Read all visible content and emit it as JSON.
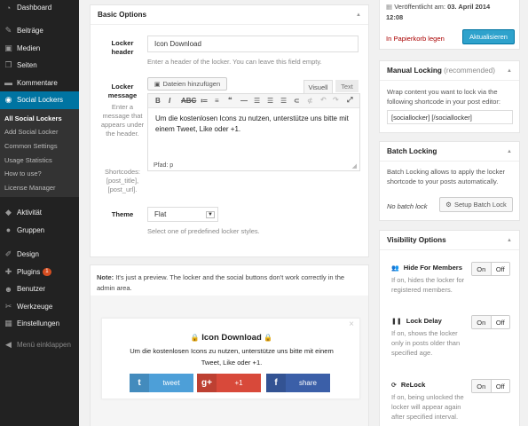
{
  "sidebar": {
    "items_top": [
      {
        "label": "Dashboard",
        "icon": "dashboard-icon",
        "glyph": "◔"
      }
    ],
    "items_mid": [
      {
        "label": "Beiträge",
        "icon": "pin-icon",
        "glyph": "✎"
      },
      {
        "label": "Medien",
        "icon": "media-icon",
        "glyph": "▣"
      },
      {
        "label": "Seiten",
        "icon": "pages-icon",
        "glyph": "❐"
      },
      {
        "label": "Kommentare",
        "icon": "comments-icon",
        "glyph": "▬"
      }
    ],
    "active": {
      "label": "Social Lockers",
      "icon": "lock-icon",
      "glyph": "◉"
    },
    "submenu": [
      "All Social Lockers",
      "Add Social Locker",
      "Common Settings",
      "Usage Statistics",
      "How to use?",
      "License Manager"
    ],
    "items_after": [
      {
        "label": "Aktivität",
        "icon": "activity-icon",
        "glyph": "◆"
      },
      {
        "label": "Gruppen",
        "icon": "groups-icon",
        "glyph": "●"
      }
    ],
    "items_bottom": [
      {
        "label": "Design",
        "icon": "design-icon",
        "glyph": "✐"
      },
      {
        "label": "Plugins",
        "icon": "plugins-icon",
        "glyph": "✚",
        "badge": "1"
      },
      {
        "label": "Benutzer",
        "icon": "users-icon",
        "glyph": "☻"
      },
      {
        "label": "Werkzeuge",
        "icon": "tools-icon",
        "glyph": "✂"
      },
      {
        "label": "Einstellungen",
        "icon": "settings-icon",
        "glyph": "▦"
      }
    ],
    "collapse": {
      "label": "Menü einklappen",
      "glyph": "◀"
    }
  },
  "basic": {
    "title": "Basic Options",
    "header_label": "Locker header",
    "header_value": "Icon Download",
    "header_help": "Enter a header of the locker. You can leave this field empty.",
    "message_label": "Locker message",
    "message_help": "Enter a message that appears under the header.",
    "shortcodes_help": "Shortcodes: [post_title], [post_url].",
    "add_media": "Dateien hinzufügen",
    "tab_visual": "Visuell",
    "tab_text": "Text",
    "editor_text": "Um die kostenlosen Icons zu nutzen, unterstütze uns bitte mit einem Tweet, Like oder +1.",
    "path": "Pfad: p",
    "theme_label": "Theme",
    "theme_value": "Flat",
    "theme_help": "Select one of predefined locker styles."
  },
  "preview": {
    "note_bold": "Note:",
    "note_text": " It's just a preview. The locker and the social buttons don't work correctly in the admin area.",
    "title": "Icon Download",
    "message": "Um die kostenlosen Icons zu nutzen, unterstütze uns bitte mit einem Tweet, Like oder +1.",
    "close": "×",
    "buttons": [
      {
        "label": "tweet",
        "icon": "twitter-icon",
        "glyph": "t",
        "color": "#4d9fd8"
      },
      {
        "label": "+1",
        "icon": "google-plus-icon",
        "glyph": "g+",
        "color": "#d8493a"
      },
      {
        "label": "share",
        "icon": "facebook-icon",
        "glyph": "f",
        "color": "#3b5fa8"
      }
    ]
  },
  "publish": {
    "published_prefix": "Veröffentlicht am:",
    "published_date": "03. April 2014",
    "published_time": "12:08",
    "trash": "In Papierkorb legen",
    "update": "Aktualisieren"
  },
  "manual": {
    "title": "Manual Locking",
    "recommended": "(recommended)",
    "text": "Wrap content you want to lock via the following shortcode in your post editor:",
    "shortcode": "[sociallocker] [/sociallocker]"
  },
  "batch": {
    "title": "Batch Locking",
    "text": "Batch Locking allows to apply the locker shortcode to your posts automatically.",
    "status": "No batch lock",
    "button": "Setup Batch Lock"
  },
  "visibility": {
    "title": "Visibility Options",
    "options": [
      {
        "label": "Hide For Members",
        "desc": "If on, hides the locker for registered members.",
        "icon": "members-icon",
        "glyph": "👥",
        "on": "On",
        "off": "Off"
      },
      {
        "label": "Lock Delay",
        "desc": "If on, shows the locker only in posts older than specified age.",
        "icon": "pause-icon",
        "glyph": "❚❚",
        "on": "On",
        "off": "Off"
      },
      {
        "label": "ReLock",
        "desc": "If on, being unlocked the locker will appear again after specified interval.",
        "icon": "relock-icon",
        "glyph": "⟳",
        "on": "On",
        "off": "Off"
      }
    ]
  },
  "colors": {
    "accent": "#0074a2",
    "primary_button": "#2ea2cc",
    "trash": "#a00",
    "sidebar": "#222"
  }
}
